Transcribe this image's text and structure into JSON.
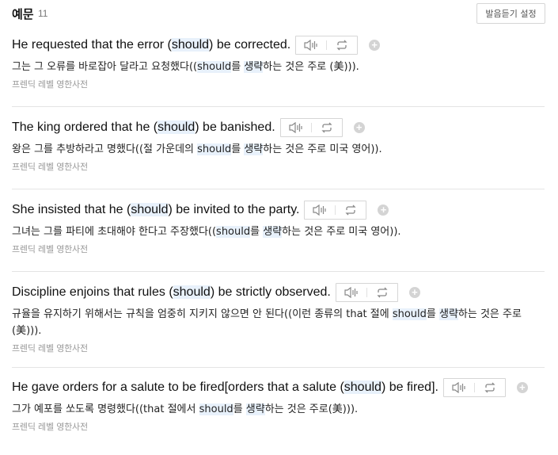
{
  "header": {
    "title": "예문",
    "count": "11",
    "settings_label": "발음듣기 설정"
  },
  "source_label": "프렌딕 레벨 영한사전",
  "examples": [
    {
      "en_before": "He requested that the error (",
      "keyword": "should",
      "en_after": ") be corrected.",
      "ko_before": "그는 그 오류를 바로잡아 달라고 요청했다((",
      "ko_kw": "should",
      "ko_mid": "를 ",
      "ko_kw2": "생략",
      "ko_after": "하는 것은 주로 (美)))."
    },
    {
      "en_before": "The king ordered that he (",
      "keyword": "should",
      "en_after": ") be banished.",
      "ko_before": "왕은 그를 추방하라고 명했다((절 가운데의 ",
      "ko_kw": "should",
      "ko_mid": "를 ",
      "ko_kw2": "생략",
      "ko_after": "하는 것은 주로 미국 영어))."
    },
    {
      "en_before": "She insisted that he (",
      "keyword": "should",
      "en_after": ") be invited to the party.",
      "ko_before": "그녀는 그를 파티에 초대해야 한다고 주장했다((",
      "ko_kw": "should",
      "ko_mid": "를 ",
      "ko_kw2": "생략",
      "ko_after": "하는 것은 주로 미국 영어))."
    },
    {
      "en_before": "Discipline enjoins that rules (",
      "keyword": "should",
      "en_after": ") be strictly observed.",
      "ko_before": "규율을 유지하기 위해서는 규칙을 엄중히 지키지 않으면 안 된다((이런 종류의 that 절에 ",
      "ko_kw": "should",
      "ko_mid": "를 ",
      "ko_kw2": "생략",
      "ko_after": "하는 것은 주로 (美)))."
    },
    {
      "en_before": "He gave orders for a salute to be fired[orders that a salute (",
      "keyword": "should",
      "en_after": ") be fired].",
      "ko_before": "그가 예포를 쏘도록 명령했다((that 절에서 ",
      "ko_kw": "should",
      "ko_mid": "를 ",
      "ko_kw2": "생략",
      "ko_after": "하는 것은 주로(美)))."
    }
  ]
}
